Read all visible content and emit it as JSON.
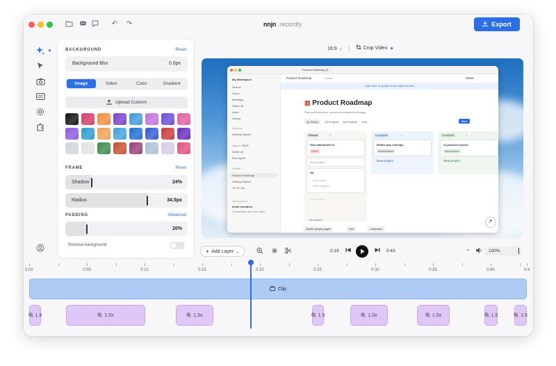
{
  "app": {
    "brand": "nnjn",
    "brand_suffix": ".recordly",
    "export_label": "Export"
  },
  "panel": {
    "background_title": "BACKGROUND",
    "background_reset": "Reset",
    "blur_label": "Background Blur",
    "blur_value": "0.0px",
    "tabs": [
      "Image",
      "Video",
      "Color",
      "Gradient"
    ],
    "active_tab": "Image",
    "upload_label": "Upload Custom",
    "frame_title": "FRAME",
    "frame_reset": "Reset",
    "shadow_label": "Shadow",
    "shadow_value": "24%",
    "radius_label": "Radius",
    "radius_value": "34.5px",
    "padding_title": "PADDING",
    "padding_link": "Advanced",
    "padding_value": "20%",
    "remove_bg_label": "Remove background",
    "swatch_colors": [
      "#101010",
      "#d43b6a",
      "#f58a3c",
      "#7a3fd0",
      "#3f9ad8",
      "#c26ee0",
      "#6a4bd8",
      "#e35da0",
      "#8c5ae0",
      "#2a9bd6",
      "#f0a050",
      "#40a0e0",
      "#1b6ed1",
      "#2f5bd3",
      "#c73a3a",
      "#6a2bbd",
      "#d0d4dc",
      "#e2e2e6",
      "#3c8a4a",
      "#c84c2c",
      "#9a3c7a",
      "#a8c0d8",
      "#d8c8e8",
      "#e05080"
    ]
  },
  "preview": {
    "aspect": "16:9",
    "crop_label": "Crop Video"
  },
  "notion": {
    "workspace": "My Workspace",
    "tab_title": "Product Roadmap (S...",
    "breadcrumb": "Product Roadmap",
    "private_tag": "Private",
    "share": "Share",
    "banner": "Click here to update to the latest version",
    "sidebar": [
      "Search",
      "Home",
      "Meetings",
      "Notion AI",
      "Inbox",
      "Library"
    ],
    "recents_title": "Recents",
    "recents": [
      "Getting Started"
    ],
    "agents_title": "Agents",
    "agents_badge": "Beta",
    "agents": [
      "Notion AI",
      "New agent"
    ],
    "private_title": "Private",
    "private_items": [
      "Product Roadmap",
      "Getting Started",
      "To Do List"
    ],
    "teamspaces_title": "Teamspaces",
    "invite_title": "Invite members",
    "invite_sub": "Collaborate with your team",
    "title": "Product Roadmap",
    "subtitle": "Plan and track your product development strategy.",
    "views": [
      "By Status",
      "All Projects",
      "My Projects",
      "Inco..."
    ],
    "new_label": "New",
    "columns": [
      {
        "name": "Planned",
        "count": "3"
      },
      {
        "name": "In progress",
        "count": "1"
      },
      {
        "name": "Completed",
        "count": "1"
      }
    ],
    "cards": {
      "planned_1": "New dashboard UI",
      "planned_1_tag": "UI/UX",
      "planned_2": "New project",
      "planned_3": "Ad",
      "planned_3_field_1": "Add owner",
      "planned_3_field_2": "Add category",
      "planned_add": "New project",
      "progress_1": "Mobile app redesign",
      "progress_1_tag": "Enhancement",
      "progress_add": "New project",
      "done_1": "AI-powered search",
      "done_1_tag": "New Feature",
      "done_add": "New project"
    },
    "get_started": "Get started",
    "buttons": [
      "Delete sample pages",
      "Tour",
      "Customize"
    ]
  },
  "controls": {
    "add_layer": "Add Layer",
    "current_time": "0:19",
    "total_time": "0:43",
    "zoom": "100%"
  },
  "timeline": {
    "ticks": [
      "0:00",
      "0:05",
      "0:10",
      "0:15",
      "0:20",
      "0:25",
      "0:30",
      "0:35",
      "0:40",
      "0:4"
    ],
    "clip_label": "Clip",
    "zoom_clips": [
      "1.5",
      "1.5x",
      "1.5x",
      "1.5",
      "1.5x",
      "1.5x",
      "1.5",
      "1.5"
    ]
  }
}
